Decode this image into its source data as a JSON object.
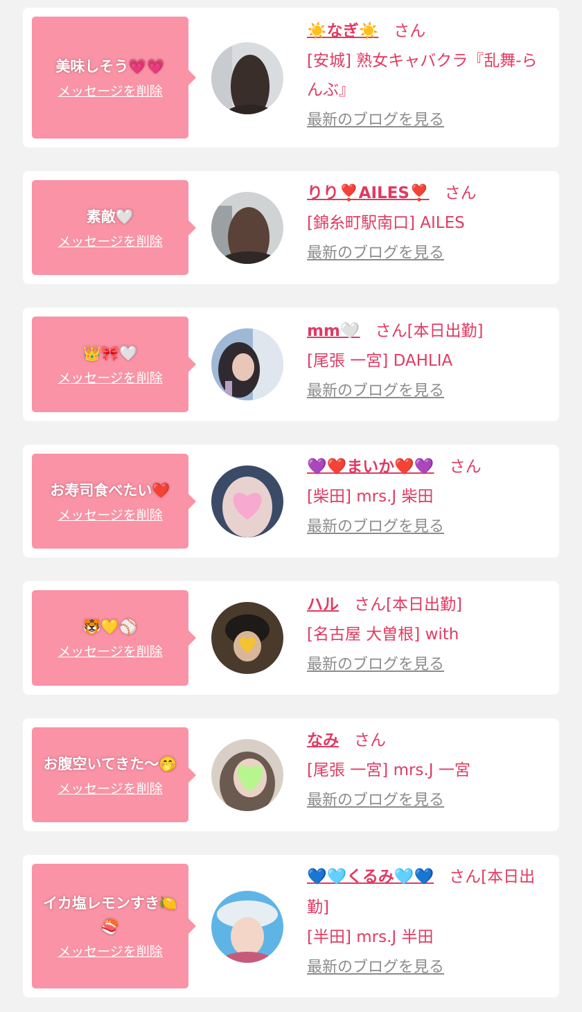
{
  "delete_label": "メッセージを削除",
  "blog_label": "最新のブログを見る",
  "san_label": "さん",
  "colors": {
    "bubble": "#f993a5",
    "accent": "#e03a62",
    "link_gray": "#8c8c8c",
    "background": "#f2f2f2"
  },
  "cards": [
    {
      "message": "美味しそう💗💗",
      "name": "☀️なぎ☀️",
      "suffix": "さん",
      "shop": "[安城] 熟女キャバクラ『乱舞-らんぶ』"
    },
    {
      "message": "素敵🤍",
      "name": "りり❣️AILES❣️",
      "suffix": "さん",
      "shop": "[錦糸町駅南口] AILES"
    },
    {
      "message": "👑🎀🤍",
      "name": "mm🤍",
      "suffix": "さん[本日出勤]",
      "shop": "[尾張 一宮] DAHLIA"
    },
    {
      "message": "お寿司食べたい❤️",
      "name": "💜❤️まいか❤️💜",
      "suffix": "さん",
      "shop": "[柴田] mrs.J 柴田"
    },
    {
      "message": "🐯💛⚾️",
      "name": "ハル",
      "suffix": "さん[本日出勤]",
      "shop": "[名古屋 大曽根] with"
    },
    {
      "message": "お腹空いてきた〜🤭",
      "name": "なみ",
      "suffix": "さん",
      "shop": "[尾張 一宮] mrs.J 一宮"
    },
    {
      "message": "イカ塩レモンすき🍋🍣",
      "name": "💙🩵くるみ🩵💙",
      "suffix": "さん[本日出勤]",
      "shop": "[半田] mrs.J 半田"
    }
  ]
}
